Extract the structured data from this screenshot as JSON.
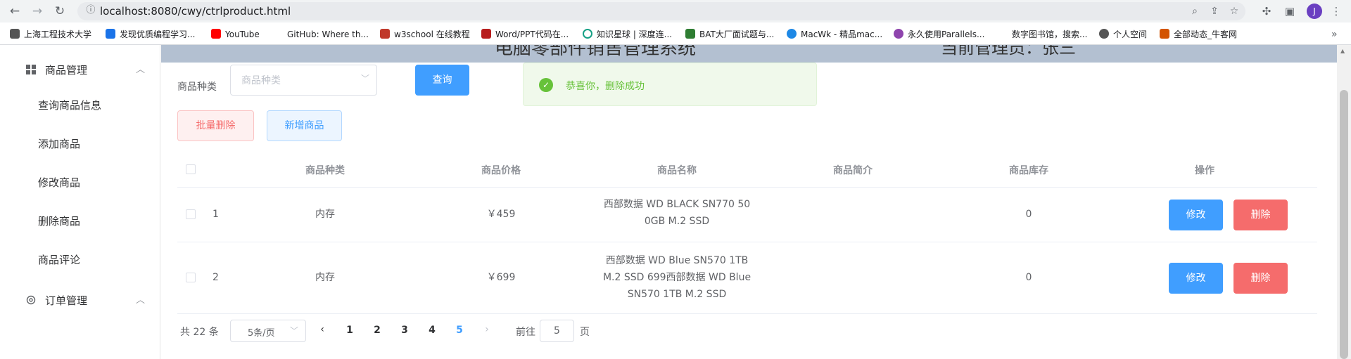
{
  "browser": {
    "url": "localhost:8080/cwy/ctrlproduct.html",
    "avatar_letter": "J",
    "bookmarks": [
      {
        "label": "上海工程技术大学",
        "color": "#555555"
      },
      {
        "label": "发现优质编程学习...",
        "color": "#1a73e8"
      },
      {
        "label": "YouTube",
        "color": "#ff0000"
      },
      {
        "label": "GitHub: Where th...",
        "color": "#24292e"
      },
      {
        "label": "w3school 在线教程",
        "color": "#c0392b"
      },
      {
        "label": "Word/PPT代码在...",
        "color": "#b71c1c"
      },
      {
        "label": "知识星球 | 深度连...",
        "color": "#16a085"
      },
      {
        "label": "BAT大厂面试题与...",
        "color": "#2e7d32"
      },
      {
        "label": "MacWk - 精品mac...",
        "color": "#1e88e5"
      },
      {
        "label": "永久使用Parallels...",
        "color": "#8e44ad"
      },
      {
        "label": "数字图书馆，搜索...",
        "color": "#555555"
      },
      {
        "label": "个人空间",
        "color": "#555555"
      },
      {
        "label": "全部动态_牛客网",
        "color": "#d35400"
      }
    ]
  },
  "header": {
    "title_partial": "电脑零部件销售管理系统",
    "user_partial": "当前管理员：张三"
  },
  "sidebar": {
    "group1": {
      "label": "商品管理",
      "icon": "grid-icon"
    },
    "items": [
      "查询商品信息",
      "添加商品",
      "修改商品",
      "删除商品",
      "商品评论"
    ],
    "group2": {
      "label": "订单管理",
      "icon": "gear-icon"
    }
  },
  "filter": {
    "label": "商品种类",
    "placeholder": "商品种类",
    "query_label": "查询"
  },
  "actions": {
    "batch_delete": "批量删除",
    "add_product": "新增商品"
  },
  "table": {
    "columns": [
      "商品种类",
      "商品价格",
      "商品名称",
      "商品简介",
      "商品库存",
      "操作"
    ],
    "rows": [
      {
        "index": "1",
        "category": "内存",
        "price": "￥459",
        "name_line1": "西部数据 WD BLACK SN770 50",
        "name_line2": "0GB M.2 SSD",
        "name_line3": "",
        "intro": "",
        "stock": "0",
        "edit": "修改",
        "delete": "删除"
      },
      {
        "index": "2",
        "category": "内存",
        "price": "￥699",
        "name_line1": "西部数据 WD Blue SN570 1TB",
        "name_line2": "M.2 SSD 699西部数据 WD Blue",
        "name_line3": "SN570 1TB M.2 SSD",
        "intro": "",
        "stock": "0",
        "edit": "修改",
        "delete": "删除"
      }
    ]
  },
  "pagination": {
    "total": "共 22 条",
    "page_size": "5条/页",
    "pages": [
      "1",
      "2",
      "3",
      "4",
      "5"
    ],
    "current": "5",
    "goto_prefix": "前往",
    "goto_value": "5",
    "goto_suffix": "页"
  },
  "toast": {
    "message": "恭喜你，删除成功"
  },
  "colors": {
    "primary": "#409eff",
    "danger": "#f56c6c",
    "success": "#67c23a",
    "header_bg": "#b3c0d1"
  }
}
